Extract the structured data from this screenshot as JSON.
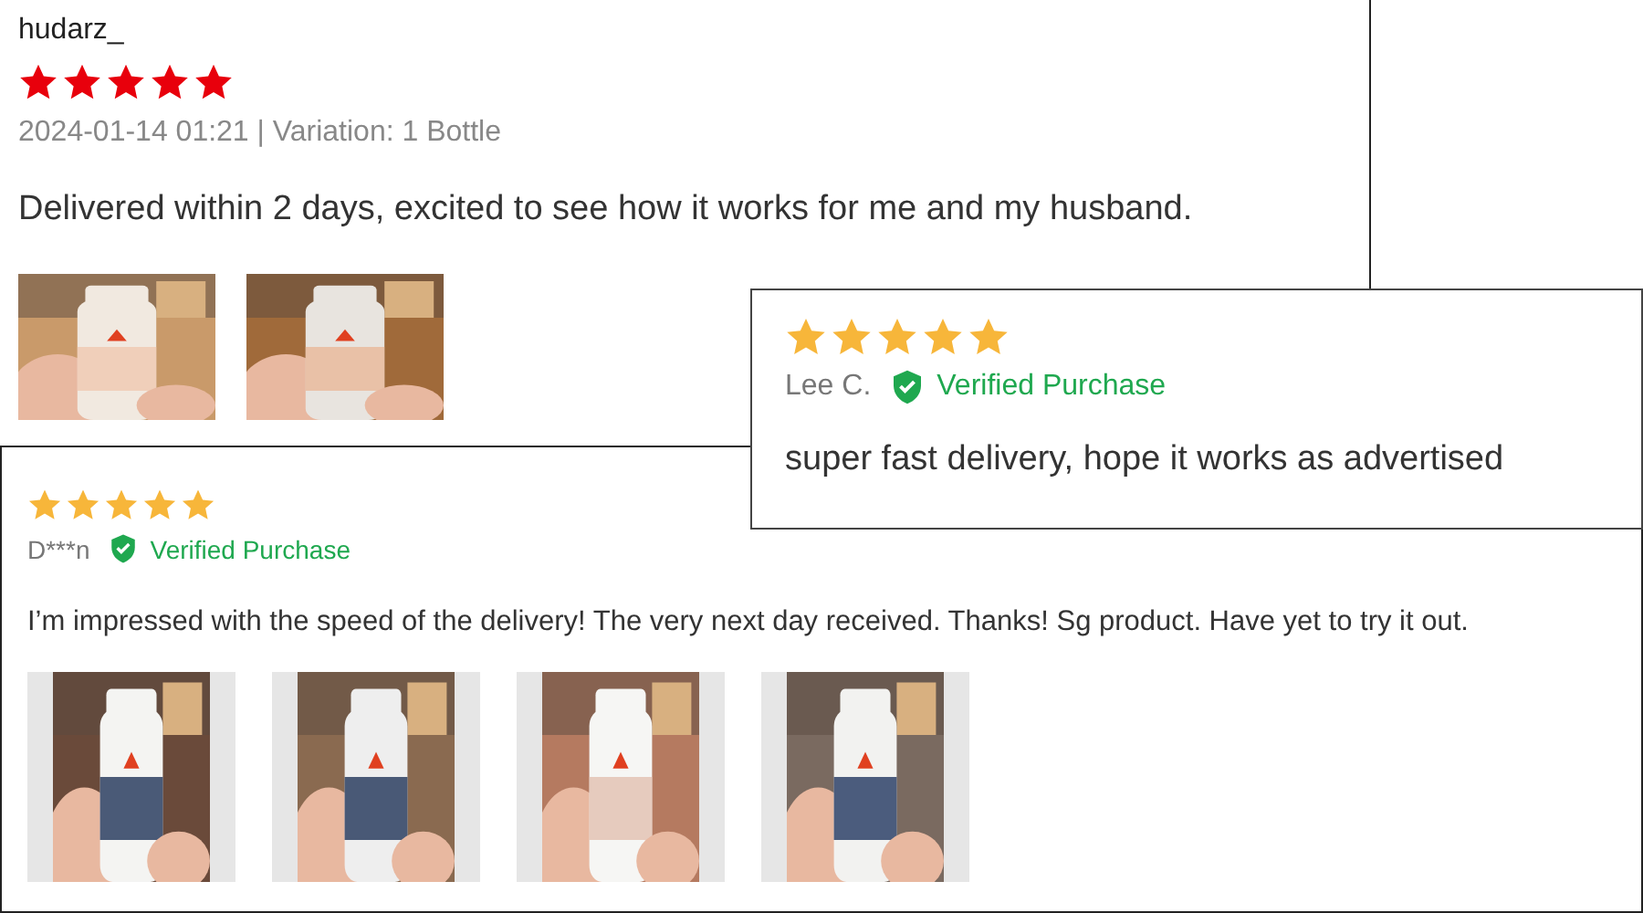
{
  "reviews": [
    {
      "kind": "shop",
      "author": "hudarz_",
      "stars": 5,
      "meta": "2024-01-14 01:21 | Variation: 1 Bottle",
      "text": "Delivered within 2 days, excited to see how it works for me and my husband.",
      "photos": [
        {
          "kind": "picture"
        },
        {
          "kind": "picture"
        }
      ]
    },
    {
      "kind": "verified",
      "stars": 5,
      "author": "Lee C.",
      "badge": "Verified Purchase",
      "text": "super fast delivery, hope it works as advertised"
    },
    {
      "kind": "verified",
      "stars": 5,
      "author": "D***n",
      "badge": "Verified Purchase",
      "text": "I’m impressed with the speed of the delivery! The very next day received. Thanks!  Sg product. Have yet to try it out.",
      "photos": [
        {
          "kind": "picture"
        },
        {
          "kind": "picture"
        },
        {
          "kind": "picture"
        },
        {
          "kind": "picture"
        }
      ]
    }
  ]
}
